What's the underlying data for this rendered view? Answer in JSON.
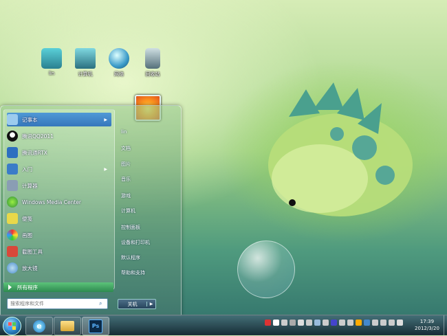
{
  "desktop": {
    "icons": [
      {
        "label": "lin",
        "icon": "user-folder-icon",
        "color": "#3aa0b0"
      },
      {
        "label": "计算机",
        "icon": "computer-icon",
        "color": "#3a8e9a"
      },
      {
        "label": "网络",
        "icon": "network-globe-icon",
        "color": "#5ab7d8"
      },
      {
        "label": "回收站",
        "icon": "recycle-bin-icon",
        "color": "#8aa2a8"
      }
    ]
  },
  "start_menu": {
    "programs": [
      {
        "label": "记事本",
        "icon": "notepad-icon",
        "color": "#6aa8d8",
        "has_arrow": true,
        "highlighted": true
      },
      {
        "label": "腾讯QQ2011",
        "icon": "qq-penguin-icon",
        "color": "#222222",
        "has_arrow": false,
        "highlighted": false
      },
      {
        "label": "腾讯通RTX",
        "icon": "rtx-icon",
        "color": "#2d6fc0",
        "has_arrow": false,
        "highlighted": false
      },
      {
        "label": "入门",
        "icon": "getting-started-icon",
        "color": "#3a7cc8",
        "has_arrow": true,
        "highlighted": false
      },
      {
        "label": "计算器",
        "icon": "calculator-icon",
        "color": "#7c8fa6",
        "has_arrow": false,
        "highlighted": false
      },
      {
        "label": "Windows Media Center",
        "icon": "media-center-icon",
        "color": "#2f8f3a",
        "has_arrow": false,
        "highlighted": false
      },
      {
        "label": "便笺",
        "icon": "sticky-notes-icon",
        "color": "#e8d84a",
        "has_arrow": false,
        "highlighted": false
      },
      {
        "label": "画图",
        "icon": "paint-icon",
        "color": "#d6804a",
        "has_arrow": false,
        "highlighted": false
      },
      {
        "label": "截图工具",
        "icon": "snipping-tool-icon",
        "color": "#d9483a",
        "has_arrow": false,
        "highlighted": false
      },
      {
        "label": "放大镜",
        "icon": "magnifier-icon",
        "color": "#4a8ed0",
        "has_arrow": false,
        "highlighted": false
      }
    ],
    "all_programs_label": "所有程序",
    "search_placeholder": "搜索程序和文件",
    "right_items": [
      "lin",
      "文档",
      "图片",
      "音乐",
      "游戏",
      "计算机",
      "控制面板",
      "设备和打印机",
      "默认程序",
      "帮助和支持"
    ],
    "shutdown_label": "关机"
  },
  "taskbar": {
    "pinned": [
      {
        "icon": "internet-explorer-icon",
        "label": "e"
      },
      {
        "icon": "explorer-folder-icon",
        "label": ""
      },
      {
        "icon": "photoshop-icon",
        "label": "Ps"
      }
    ],
    "tray_colors": [
      "#d33",
      "#fff",
      "#ccc",
      "#aaa",
      "#ddd",
      "#ccc",
      "#9bd",
      "#ccc",
      "#44c",
      "#ccc",
      "#ccc",
      "#fa0",
      "#48c",
      "#ccc",
      "#ccc",
      "#ccc",
      "#ddd"
    ],
    "clock_time": "17:39",
    "clock_date": "2012/3/20"
  }
}
